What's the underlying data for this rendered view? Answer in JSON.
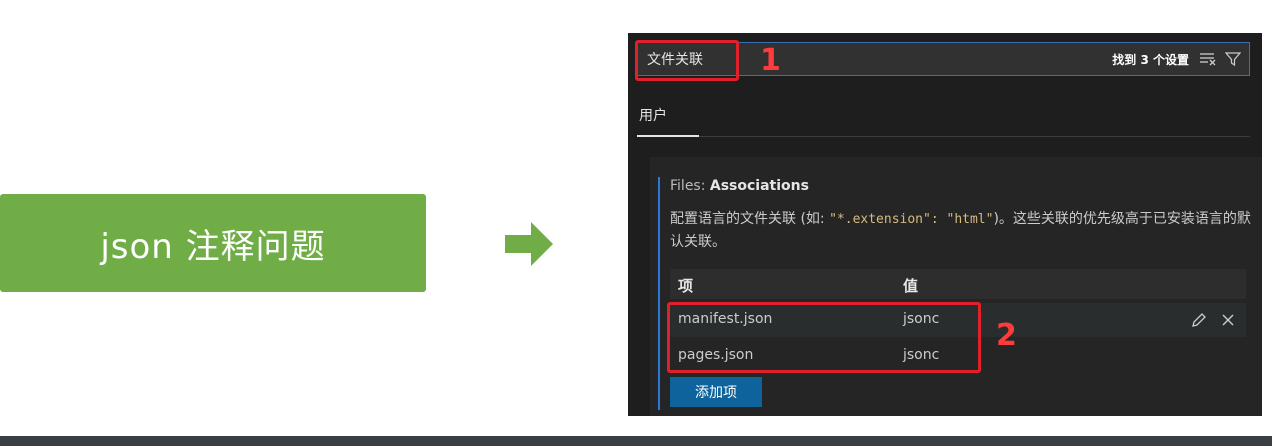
{
  "label": {
    "text": "json 注释问题",
    "color": "#70ad47"
  },
  "arrow": {
    "icon": "arrow-right-icon",
    "color": "#70ad47"
  },
  "settings": {
    "search": {
      "value": "文件关联",
      "result_count": "找到 3 个设置"
    },
    "tabs": [
      {
        "label": "用户"
      }
    ],
    "setting": {
      "category": "Files: ",
      "name": "Associations",
      "description_before": "配置语言的文件关联 (如: ",
      "description_code": "\"*.extension\": \"html\"",
      "description_after": ")。这些关联的优先级高于已安装语言的默认关联。",
      "table": {
        "headers": {
          "key": "项",
          "value": "值"
        },
        "rows": [
          {
            "key": "manifest.json",
            "value": "jsonc"
          },
          {
            "key": "pages.json",
            "value": "jsonc"
          }
        ]
      },
      "add_button": "添加项"
    }
  },
  "annotations": {
    "marker_1": "1",
    "marker_2": "2",
    "color": "#e0202a"
  }
}
